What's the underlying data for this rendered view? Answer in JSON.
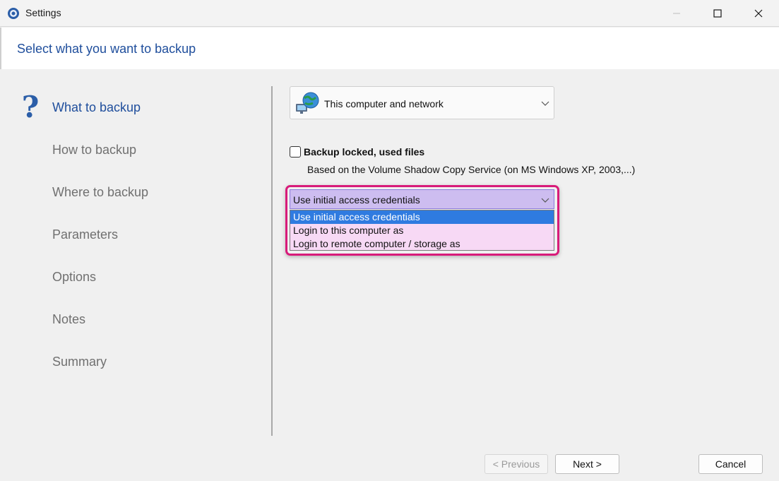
{
  "window": {
    "title": "Settings",
    "controls": [
      "minimize",
      "maximize",
      "close"
    ]
  },
  "header": {
    "title": "Select what you want to backup"
  },
  "nav": {
    "items": [
      {
        "label": "What to backup",
        "active": true
      },
      {
        "label": "How to backup",
        "active": false
      },
      {
        "label": "Where to backup",
        "active": false
      },
      {
        "label": "Parameters",
        "active": false
      },
      {
        "label": "Options",
        "active": false
      },
      {
        "label": "Notes",
        "active": false
      },
      {
        "label": "Summary",
        "active": false
      }
    ],
    "active_icon": "question-mark-icon"
  },
  "source": {
    "selected": "This computer and network",
    "icon": "network-globe-icon"
  },
  "locked_files": {
    "label": "Backup locked, used files",
    "description": "Based on the Volume Shadow Copy Service  (on MS Windows XP, 2003,...)",
    "checked": false
  },
  "credentials": {
    "selected": "Use initial access credentials",
    "options": [
      {
        "label": "Use initial access credentials",
        "selected": true
      },
      {
        "label": "Login to this computer as",
        "selected": false
      },
      {
        "label": "Login to remote computer / storage as",
        "selected": false
      }
    ]
  },
  "footer": {
    "previous_label": "< Previous",
    "next_label": "Next >",
    "cancel_label": "Cancel"
  },
  "colors": {
    "accent": "#1f4e9c",
    "highlight_border": "#d81b7a",
    "selected_option": "#2f7be0",
    "dropdown_bg": "#f7d9f5",
    "select_bg": "#cdbdf0"
  }
}
